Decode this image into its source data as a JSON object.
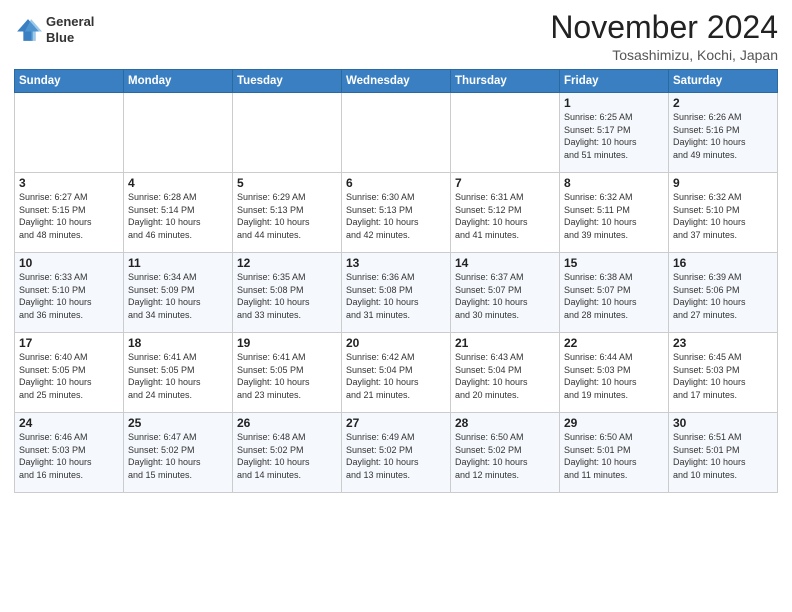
{
  "header": {
    "logo_line1": "General",
    "logo_line2": "Blue",
    "month": "November 2024",
    "location": "Tosashimizu, Kochi, Japan"
  },
  "weekdays": [
    "Sunday",
    "Monday",
    "Tuesday",
    "Wednesday",
    "Thursday",
    "Friday",
    "Saturday"
  ],
  "weeks": [
    [
      {
        "day": "",
        "info": ""
      },
      {
        "day": "",
        "info": ""
      },
      {
        "day": "",
        "info": ""
      },
      {
        "day": "",
        "info": ""
      },
      {
        "day": "",
        "info": ""
      },
      {
        "day": "1",
        "info": "Sunrise: 6:25 AM\nSunset: 5:17 PM\nDaylight: 10 hours\nand 51 minutes."
      },
      {
        "day": "2",
        "info": "Sunrise: 6:26 AM\nSunset: 5:16 PM\nDaylight: 10 hours\nand 49 minutes."
      }
    ],
    [
      {
        "day": "3",
        "info": "Sunrise: 6:27 AM\nSunset: 5:15 PM\nDaylight: 10 hours\nand 48 minutes."
      },
      {
        "day": "4",
        "info": "Sunrise: 6:28 AM\nSunset: 5:14 PM\nDaylight: 10 hours\nand 46 minutes."
      },
      {
        "day": "5",
        "info": "Sunrise: 6:29 AM\nSunset: 5:13 PM\nDaylight: 10 hours\nand 44 minutes."
      },
      {
        "day": "6",
        "info": "Sunrise: 6:30 AM\nSunset: 5:13 PM\nDaylight: 10 hours\nand 42 minutes."
      },
      {
        "day": "7",
        "info": "Sunrise: 6:31 AM\nSunset: 5:12 PM\nDaylight: 10 hours\nand 41 minutes."
      },
      {
        "day": "8",
        "info": "Sunrise: 6:32 AM\nSunset: 5:11 PM\nDaylight: 10 hours\nand 39 minutes."
      },
      {
        "day": "9",
        "info": "Sunrise: 6:32 AM\nSunset: 5:10 PM\nDaylight: 10 hours\nand 37 minutes."
      }
    ],
    [
      {
        "day": "10",
        "info": "Sunrise: 6:33 AM\nSunset: 5:10 PM\nDaylight: 10 hours\nand 36 minutes."
      },
      {
        "day": "11",
        "info": "Sunrise: 6:34 AM\nSunset: 5:09 PM\nDaylight: 10 hours\nand 34 minutes."
      },
      {
        "day": "12",
        "info": "Sunrise: 6:35 AM\nSunset: 5:08 PM\nDaylight: 10 hours\nand 33 minutes."
      },
      {
        "day": "13",
        "info": "Sunrise: 6:36 AM\nSunset: 5:08 PM\nDaylight: 10 hours\nand 31 minutes."
      },
      {
        "day": "14",
        "info": "Sunrise: 6:37 AM\nSunset: 5:07 PM\nDaylight: 10 hours\nand 30 minutes."
      },
      {
        "day": "15",
        "info": "Sunrise: 6:38 AM\nSunset: 5:07 PM\nDaylight: 10 hours\nand 28 minutes."
      },
      {
        "day": "16",
        "info": "Sunrise: 6:39 AM\nSunset: 5:06 PM\nDaylight: 10 hours\nand 27 minutes."
      }
    ],
    [
      {
        "day": "17",
        "info": "Sunrise: 6:40 AM\nSunset: 5:05 PM\nDaylight: 10 hours\nand 25 minutes."
      },
      {
        "day": "18",
        "info": "Sunrise: 6:41 AM\nSunset: 5:05 PM\nDaylight: 10 hours\nand 24 minutes."
      },
      {
        "day": "19",
        "info": "Sunrise: 6:41 AM\nSunset: 5:05 PM\nDaylight: 10 hours\nand 23 minutes."
      },
      {
        "day": "20",
        "info": "Sunrise: 6:42 AM\nSunset: 5:04 PM\nDaylight: 10 hours\nand 21 minutes."
      },
      {
        "day": "21",
        "info": "Sunrise: 6:43 AM\nSunset: 5:04 PM\nDaylight: 10 hours\nand 20 minutes."
      },
      {
        "day": "22",
        "info": "Sunrise: 6:44 AM\nSunset: 5:03 PM\nDaylight: 10 hours\nand 19 minutes."
      },
      {
        "day": "23",
        "info": "Sunrise: 6:45 AM\nSunset: 5:03 PM\nDaylight: 10 hours\nand 17 minutes."
      }
    ],
    [
      {
        "day": "24",
        "info": "Sunrise: 6:46 AM\nSunset: 5:03 PM\nDaylight: 10 hours\nand 16 minutes."
      },
      {
        "day": "25",
        "info": "Sunrise: 6:47 AM\nSunset: 5:02 PM\nDaylight: 10 hours\nand 15 minutes."
      },
      {
        "day": "26",
        "info": "Sunrise: 6:48 AM\nSunset: 5:02 PM\nDaylight: 10 hours\nand 14 minutes."
      },
      {
        "day": "27",
        "info": "Sunrise: 6:49 AM\nSunset: 5:02 PM\nDaylight: 10 hours\nand 13 minutes."
      },
      {
        "day": "28",
        "info": "Sunrise: 6:50 AM\nSunset: 5:02 PM\nDaylight: 10 hours\nand 12 minutes."
      },
      {
        "day": "29",
        "info": "Sunrise: 6:50 AM\nSunset: 5:01 PM\nDaylight: 10 hours\nand 11 minutes."
      },
      {
        "day": "30",
        "info": "Sunrise: 6:51 AM\nSunset: 5:01 PM\nDaylight: 10 hours\nand 10 minutes."
      }
    ]
  ]
}
